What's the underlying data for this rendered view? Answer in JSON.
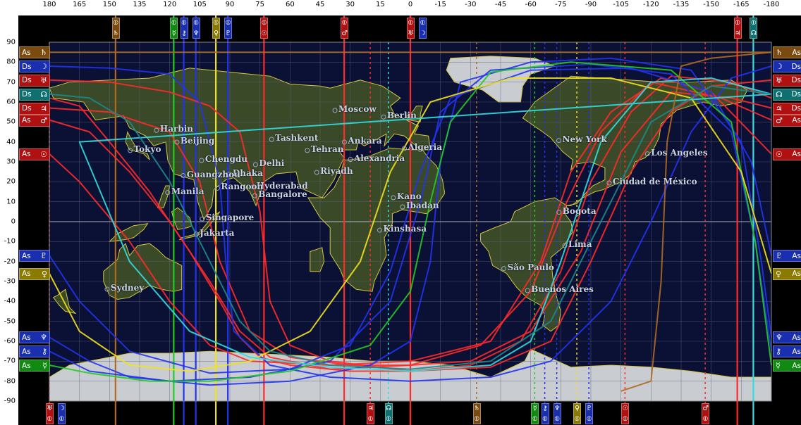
{
  "top_ruler": [
    "180",
    "165",
    "150",
    "135",
    "120",
    "105",
    "90",
    "75",
    "60",
    "45",
    "30",
    "15",
    "0",
    "-15",
    "-30",
    "-45",
    "-60",
    "-75",
    "-90",
    "-105",
    "-120",
    "-135",
    "-150",
    "-165",
    "-180"
  ],
  "lat_axis": [
    "90",
    "80",
    "70",
    "60",
    "50",
    "40",
    "30",
    "20",
    "10",
    "0",
    "-10",
    "-20",
    "-30",
    "-40",
    "-50",
    "-60",
    "-70",
    "-80",
    "-90"
  ],
  "cities": [
    {
      "name": "Los Angeles",
      "lon": -118.2,
      "lat": 34.0
    },
    {
      "name": "Ciudad de México",
      "lon": -99.1,
      "lat": 19.4
    },
    {
      "name": "New York",
      "lon": -74.0,
      "lat": 40.7
    },
    {
      "name": "Bogota",
      "lon": -74.1,
      "lat": 4.7
    },
    {
      "name": "Lima",
      "lon": -77.0,
      "lat": -12.0
    },
    {
      "name": "São Paulo",
      "lon": -46.6,
      "lat": -23.5
    },
    {
      "name": "Buenos Aires",
      "lon": -58.4,
      "lat": -34.6
    },
    {
      "name": "Berlin",
      "lon": 13.4,
      "lat": 52.5
    },
    {
      "name": "Moscow",
      "lon": 37.6,
      "lat": 55.8
    },
    {
      "name": "Algeria",
      "lon": 3.0,
      "lat": 36.7
    },
    {
      "name": "Ankara",
      "lon": 32.9,
      "lat": 39.9
    },
    {
      "name": "Alexandria",
      "lon": 29.9,
      "lat": 31.2
    },
    {
      "name": "Tehran",
      "lon": 51.4,
      "lat": 35.7
    },
    {
      "name": "Tashkent",
      "lon": 69.2,
      "lat": 41.3
    },
    {
      "name": "Riyadh",
      "lon": 46.7,
      "lat": 24.7
    },
    {
      "name": "Delhi",
      "lon": 77.2,
      "lat": 28.6
    },
    {
      "name": "Kano",
      "lon": 8.5,
      "lat": 12.0
    },
    {
      "name": "Ibadan",
      "lon": 3.9,
      "lat": 7.4
    },
    {
      "name": "Kinshasa",
      "lon": 15.3,
      "lat": -4.3
    },
    {
      "name": "Hyderabad",
      "lon": 78.5,
      "lat": 17.4
    },
    {
      "name": "Bangalore",
      "lon": 77.6,
      "lat": 12.97
    },
    {
      "name": "Dhaka",
      "lon": 90.4,
      "lat": 23.8
    },
    {
      "name": "Chengdu",
      "lon": 104.1,
      "lat": 30.7
    },
    {
      "name": "Guangzhou",
      "lon": 113.3,
      "lat": 23.1
    },
    {
      "name": "Rangoon",
      "lon": 96.2,
      "lat": 16.8
    },
    {
      "name": "Manila",
      "lon": 121.0,
      "lat": 14.6
    },
    {
      "name": "Singapore",
      "lon": 103.8,
      "lat": 1.35
    },
    {
      "name": "Jakarta",
      "lon": 106.8,
      "lat": -6.2
    },
    {
      "name": "Harbin",
      "lon": 126.6,
      "lat": 45.8
    },
    {
      "name": "Beijing",
      "lon": 116.4,
      "lat": 39.9
    },
    {
      "name": "Tokyo",
      "lon": 139.7,
      "lat": 35.7
    },
    {
      "name": "Sydney",
      "lon": 151.2,
      "lat": -33.9
    }
  ],
  "left_tags": [
    {
      "text": "As",
      "glyph": "♄",
      "lat": 85,
      "color": "#7a4a0e"
    },
    {
      "text": "Ds",
      "glyph": "☽",
      "lat": 78,
      "color": "#1a2fb0"
    },
    {
      "text": "Ds",
      "glyph": "♅",
      "lat": 71,
      "color": "#b01010"
    },
    {
      "text": "Ds",
      "glyph": "☊",
      "lat": 64,
      "color": "#0e7070"
    },
    {
      "text": "Ds",
      "glyph": "♃",
      "lat": 57,
      "color": "#b01010"
    },
    {
      "text": "As",
      "glyph": "♂",
      "lat": 51,
      "color": "#b01010"
    },
    {
      "text": "As",
      "glyph": "☉",
      "lat": 34,
      "color": "#b01010"
    },
    {
      "text": "As",
      "glyph": "♇",
      "lat": -17,
      "color": "#1a2fb0"
    },
    {
      "text": "As",
      "glyph": "♀",
      "lat": -26,
      "color": "#8a7a00"
    },
    {
      "text": "As",
      "glyph": "♆",
      "lat": -58,
      "color": "#1a2fb0"
    },
    {
      "text": "As",
      "glyph": "⚷",
      "lat": -65,
      "color": "#1a2fb0"
    },
    {
      "text": "As",
      "glyph": "☿",
      "lat": -72,
      "color": "#108a10"
    }
  ],
  "right_tags": [
    {
      "text": "As",
      "glyph": "♄",
      "lat": 85,
      "color": "#7a4a0e"
    },
    {
      "text": "Ds",
      "glyph": "☽",
      "lat": 78,
      "color": "#1a2fb0"
    },
    {
      "text": "Ds",
      "glyph": "♅",
      "lat": 71,
      "color": "#b01010"
    },
    {
      "text": "Ds",
      "glyph": "☊",
      "lat": 64,
      "color": "#0e7070"
    },
    {
      "text": "Ds",
      "glyph": "♃",
      "lat": 57,
      "color": "#b01010"
    },
    {
      "text": "As",
      "glyph": "♂",
      "lat": 51,
      "color": "#b01010"
    },
    {
      "text": "As",
      "glyph": "☉",
      "lat": 34,
      "color": "#b01010"
    },
    {
      "text": "As",
      "glyph": "♇",
      "lat": -17,
      "color": "#1a2fb0"
    },
    {
      "text": "As",
      "glyph": "♀",
      "lat": -26,
      "color": "#8a7a00"
    },
    {
      "text": "As",
      "glyph": "♆",
      "lat": -58,
      "color": "#1a2fb0"
    },
    {
      "text": "As",
      "glyph": "⚷",
      "lat": -65,
      "color": "#1a2fb0"
    },
    {
      "text": "As",
      "glyph": "☿",
      "lat": -72,
      "color": "#108a10"
    }
  ],
  "top_col_tags": [
    {
      "lon": 147,
      "top": "MC",
      "glyph": "♄",
      "color": "#7a4a0e"
    },
    {
      "lon": 118,
      "top": "MC",
      "glyph": "☿",
      "color": "#108a10"
    },
    {
      "lon": 113,
      "top": "MC",
      "glyph": "⚷",
      "color": "#1a2fb0"
    },
    {
      "lon": 107,
      "top": "MC",
      "glyph": "♆",
      "color": "#1a2fb0"
    },
    {
      "lon": 97,
      "top": "MC",
      "glyph": "♀",
      "color": "#8a7a00"
    },
    {
      "lon": 91,
      "top": "MC",
      "glyph": "♇",
      "color": "#1a2fb0"
    },
    {
      "lon": 73,
      "top": "MC",
      "glyph": "☉",
      "color": "#b01010"
    },
    {
      "lon": 33,
      "top": "MC",
      "glyph": "♂",
      "color": "#b01010"
    },
    {
      "lon": 0,
      "top": "MC",
      "glyph": "♅",
      "color": "#b01010"
    },
    {
      "lon": -6,
      "top": "MC",
      "glyph": "☽",
      "color": "#1a2fb0"
    },
    {
      "lon": -163,
      "top": "MC",
      "glyph": "♃",
      "color": "#b01010"
    },
    {
      "lon": -171,
      "top": "MC",
      "glyph": "☊",
      "color": "#0e7070"
    }
  ],
  "bottom_col_tags": [
    {
      "lon": 180,
      "glyph": "♅",
      "color": "#b01010"
    },
    {
      "lon": 174,
      "glyph": "☽",
      "color": "#1a2fb0"
    },
    {
      "lon": 20,
      "glyph": "♃",
      "color": "#b01010"
    },
    {
      "lon": 11,
      "glyph": "☊",
      "color": "#0e7070"
    },
    {
      "lon": -33,
      "glyph": "♄",
      "color": "#7a4a0e"
    },
    {
      "lon": -62,
      "glyph": "☿",
      "color": "#108a10"
    },
    {
      "lon": -67,
      "glyph": "⚷",
      "color": "#1a2fb0"
    },
    {
      "lon": -73,
      "glyph": "♆",
      "color": "#1a2fb0"
    },
    {
      "lon": -83,
      "glyph": "♀",
      "color": "#8a7a00"
    },
    {
      "lon": -89,
      "glyph": "♇",
      "color": "#1a2fb0"
    },
    {
      "lon": -107,
      "glyph": "☉",
      "color": "#b01010"
    },
    {
      "lon": -147,
      "glyph": "♂",
      "color": "#b01010"
    }
  ],
  "mc_lines": [
    {
      "lon": 147,
      "color": "#b06a20"
    },
    {
      "lon": 118,
      "color": "#22cc22"
    },
    {
      "lon": 113,
      "color": "#2233ee"
    },
    {
      "lon": 107,
      "color": "#2233ee"
    },
    {
      "lon": 97,
      "color": "#f2e21a"
    },
    {
      "lon": 91,
      "color": "#2233ee"
    },
    {
      "lon": 73,
      "color": "#ff2a2a"
    },
    {
      "lon": 33,
      "color": "#ff2a2a"
    },
    {
      "lon": 0,
      "color": "#ff2a2a"
    },
    {
      "lon": -163,
      "color": "#ff2a2a"
    },
    {
      "lon": -171,
      "color": "#33dddd"
    }
  ],
  "ic_lines": [
    {
      "lon": 180,
      "color": "#ff2a2a"
    },
    {
      "lon": 20,
      "color": "#ff2a2a"
    },
    {
      "lon": 11,
      "color": "#33dddd"
    },
    {
      "lon": -33,
      "color": "#b06a20"
    },
    {
      "lon": -62,
      "color": "#22cc22"
    },
    {
      "lon": -67,
      "color": "#2233ee"
    },
    {
      "lon": -73,
      "color": "#2233ee"
    },
    {
      "lon": -83,
      "color": "#f2e21a"
    },
    {
      "lon": -89,
      "color": "#2233ee"
    },
    {
      "lon": -107,
      "color": "#ff2a2a"
    },
    {
      "lon": -147,
      "color": "#ff2a2a"
    }
  ],
  "colors": {
    "ocean": "#0b1035",
    "land": "#3a4a28",
    "coast": "#d4c640",
    "grid": "#5e6478"
  }
}
